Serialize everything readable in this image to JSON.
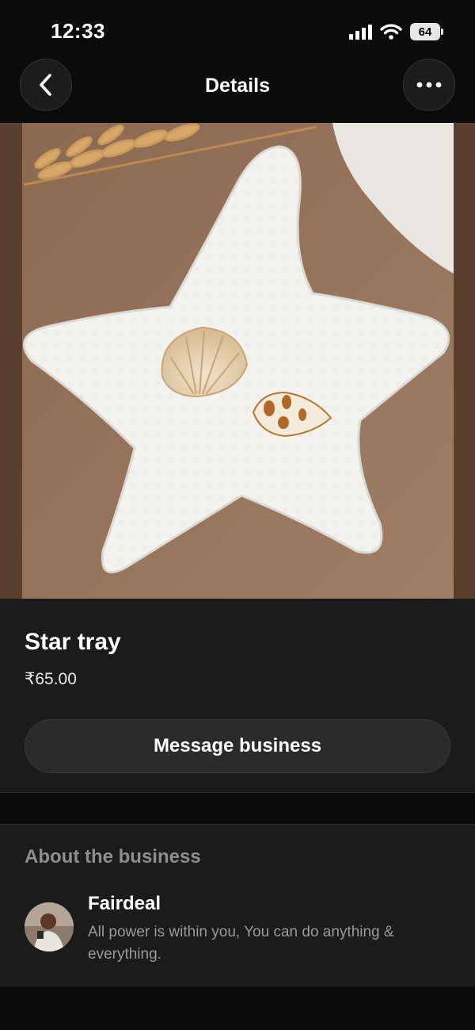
{
  "status_bar": {
    "time": "12:33",
    "battery": "64",
    "icons": [
      "signal-icon",
      "wifi-icon",
      "battery-icon"
    ]
  },
  "nav": {
    "title": "Details",
    "back_icon": "chevron-left-icon",
    "more_icon": "ellipsis-icon"
  },
  "product": {
    "image": "white starfish-shaped ceramic tray with two seashells",
    "name": "Star tray",
    "price": "₹65.00",
    "message_button_label": "Message business"
  },
  "about": {
    "heading": "About the business",
    "business_name": "Fairdeal",
    "description": "All power is within you, You can do anything & everything."
  },
  "colors": {
    "background": "#0b0b0b",
    "card": "#1b1b1b",
    "button": "#2b2b2b",
    "muted_text": "#8e8e8e"
  }
}
